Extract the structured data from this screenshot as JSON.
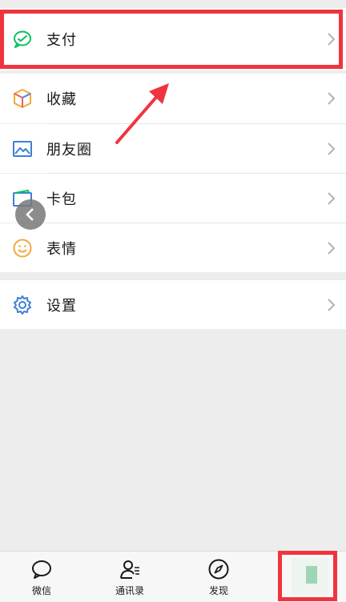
{
  "menu": {
    "payment": "支付",
    "favorites": "收藏",
    "moments": "朋友圈",
    "cards": "卡包",
    "stickers": "表情",
    "settings": "设置"
  },
  "tabbar": {
    "chats": "微信",
    "contacts": "通讯录",
    "discover": "发现"
  },
  "colors": {
    "highlight": "#f0343f",
    "wechat_green": "#07c160",
    "background": "#ededed"
  }
}
